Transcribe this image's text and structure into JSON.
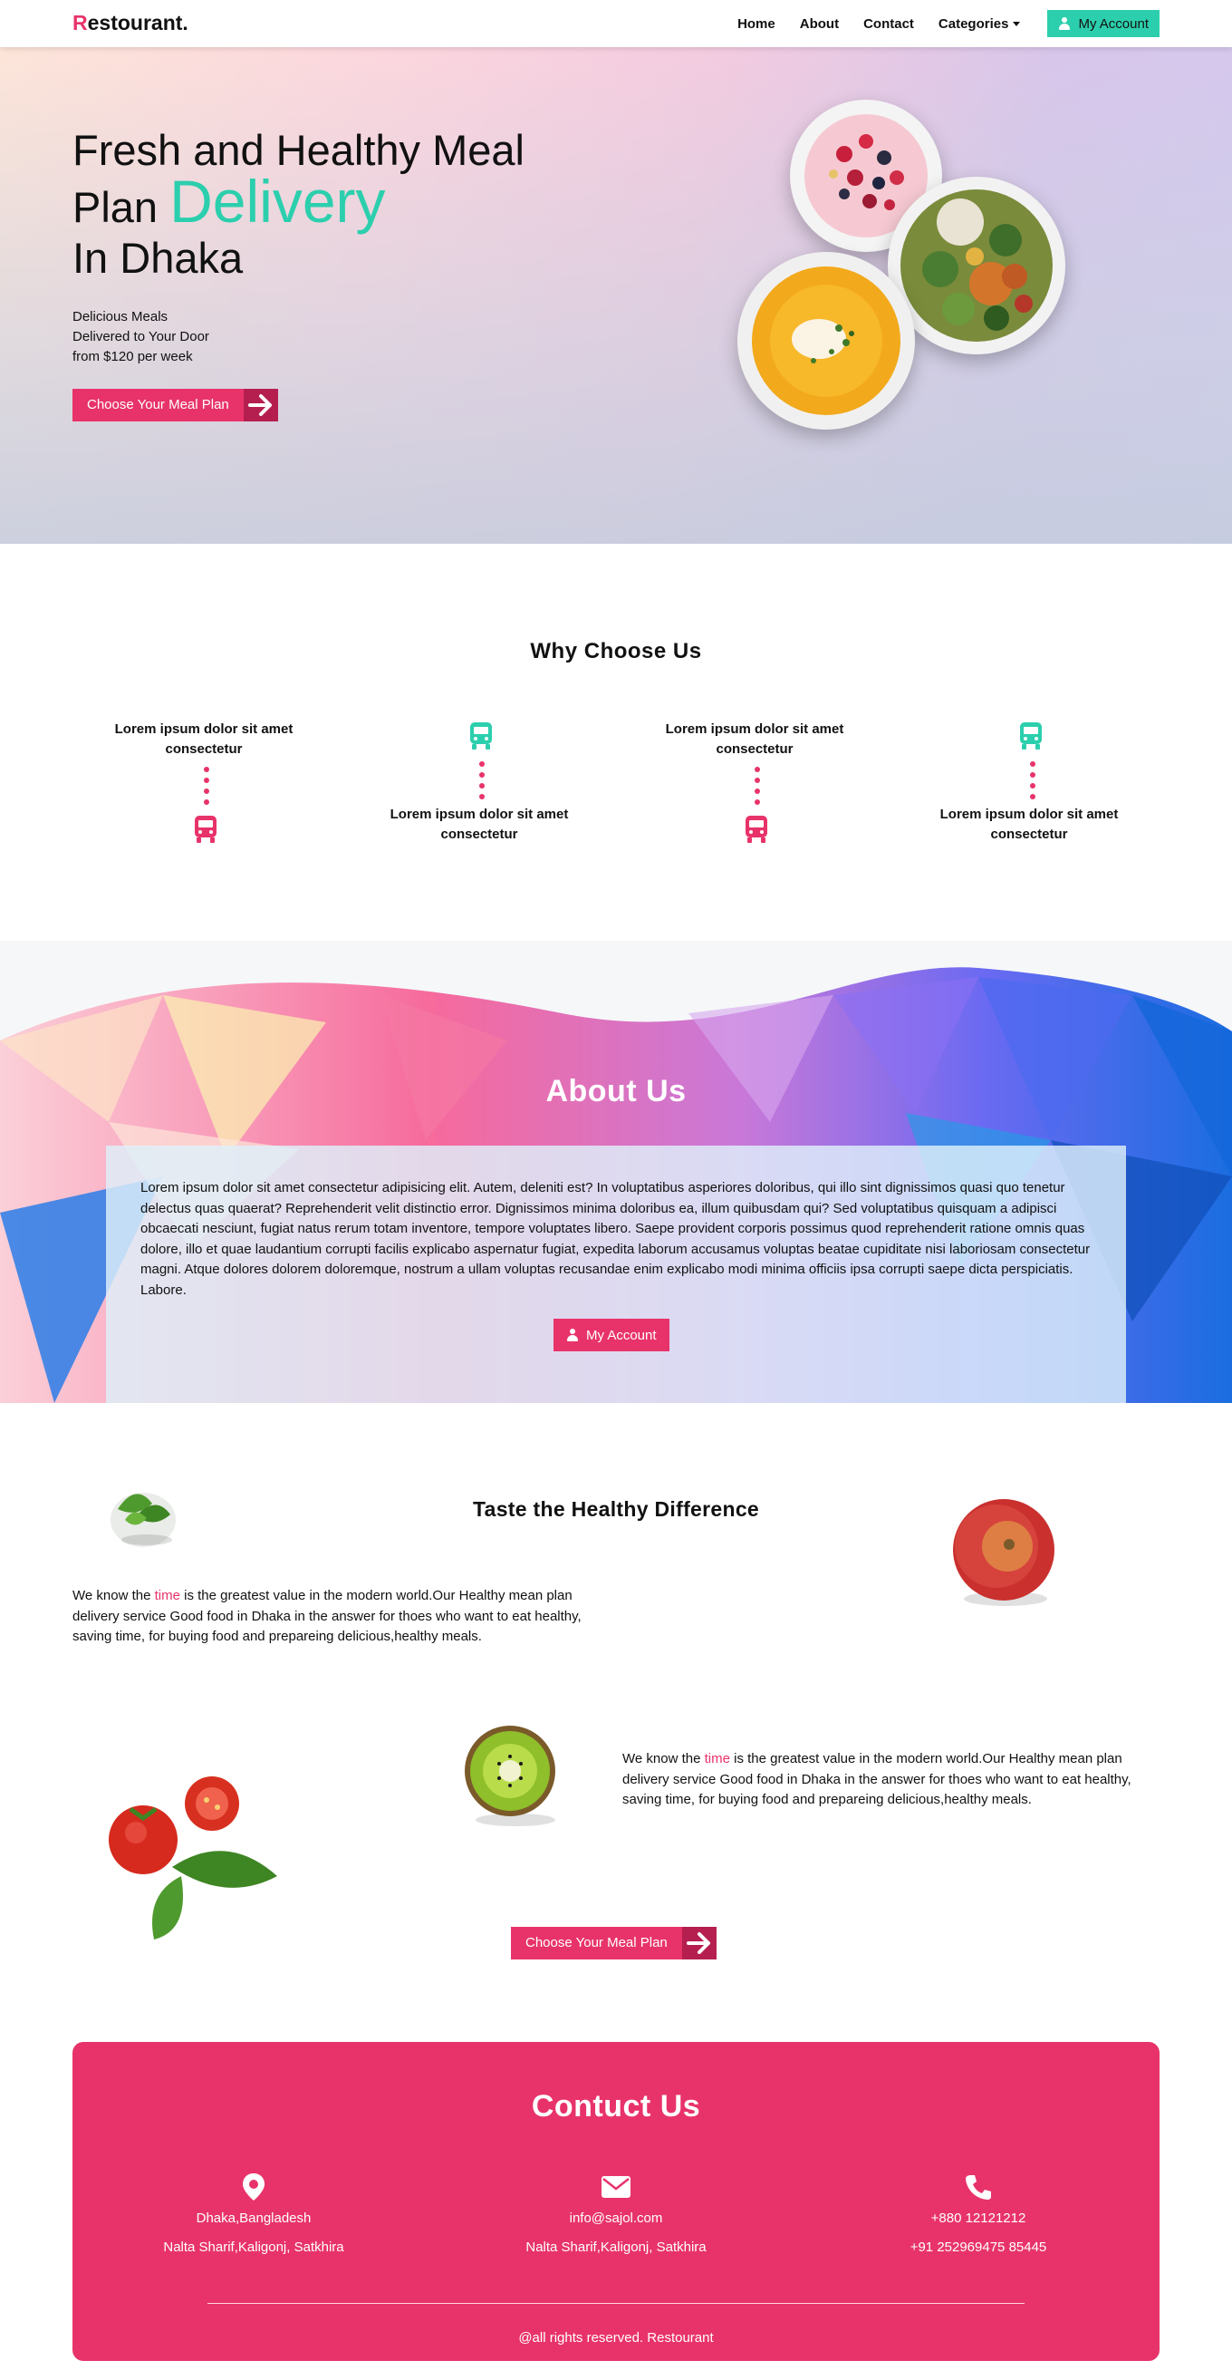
{
  "nav": {
    "logo_initial": "R",
    "logo_rest": "estourant.",
    "links": [
      "Home",
      "About",
      "Contact",
      "Categories"
    ],
    "account_label": "My Account"
  },
  "hero": {
    "title_line1": "Fresh and Healthy Meal",
    "title_line2_plain": "Plan ",
    "title_line2_accent": "Delivery",
    "title_line3": "In Dhaka",
    "sub_line1": "Delicious Meals",
    "sub_line2": "Delivered to Your Door",
    "sub_line3": "from $120 per week",
    "cta_label": "Choose Your Meal Plan"
  },
  "why": {
    "title": "Why Choose Us",
    "features": [
      "Lorem ipsum dolor sit amet consectetur",
      "Lorem ipsum dolor sit amet consectetur",
      "Lorem ipsum dolor sit amet consectetur",
      "Lorem ipsum dolor sit amet consectetur"
    ]
  },
  "about": {
    "title": "About Us",
    "text": "Lorem ipsum dolor sit amet consectetur adipisicing elit. Autem, deleniti est? In voluptatibus asperiores doloribus, qui illo sint dignissimos quasi quo tenetur delectus quas quaerat? Reprehenderit velit distinctio error. Dignissimos minima doloribus ea, illum quibusdam qui? Sed voluptatibus quisquam a adipisci obcaecati nesciunt, fugiat natus rerum totam inventore, tempore voluptates libero. Saepe provident corporis possimus quod reprehenderit ratione omnis quas dolore, illo et quae laudantium corrupti facilis explicabo aspernatur fugiat, expedita laborum accusamus voluptas beatae cupiditate nisi laboriosam consectetur magni. Atque dolores dolorem doloremque, nostrum a ullam voluptas recusandae enim explicabo modi minima officiis ipsa corrupti saepe dicta perspiciatis. Labore.",
    "button_label": "My Account"
  },
  "taste": {
    "title": "Taste the Healthy Difference",
    "para_before": "We know the ",
    "para_highlight": "time",
    "para_after": " is the greatest value in the modern world.Our Healthy mean plan delivery service Good food in Dhaka in the answer for thoes who want to eat healthy, saving time, for buying food and prepareing delicious,healthy meals.",
    "cta_label": "Choose Your Meal Plan"
  },
  "contact": {
    "title": "Contuct Us",
    "columns": [
      {
        "icon": "location-pin-icon",
        "line1": "Dhaka,Bangladesh",
        "line2": "Nalta Sharif,Kaligonj, Satkhira"
      },
      {
        "icon": "envelope-icon",
        "line1": "info@sajol.com",
        "line2": "Nalta Sharif,Kaligonj, Satkhira"
      },
      {
        "icon": "phone-icon",
        "line1": "+880 12121212",
        "line2": "+91 252969475 85445"
      }
    ],
    "footer": "@all rights reserved. Restourant"
  },
  "colors": {
    "accent_pink": "#e8336a",
    "accent_teal": "#2ccfad",
    "arrow_dark": "#b51f4f"
  }
}
